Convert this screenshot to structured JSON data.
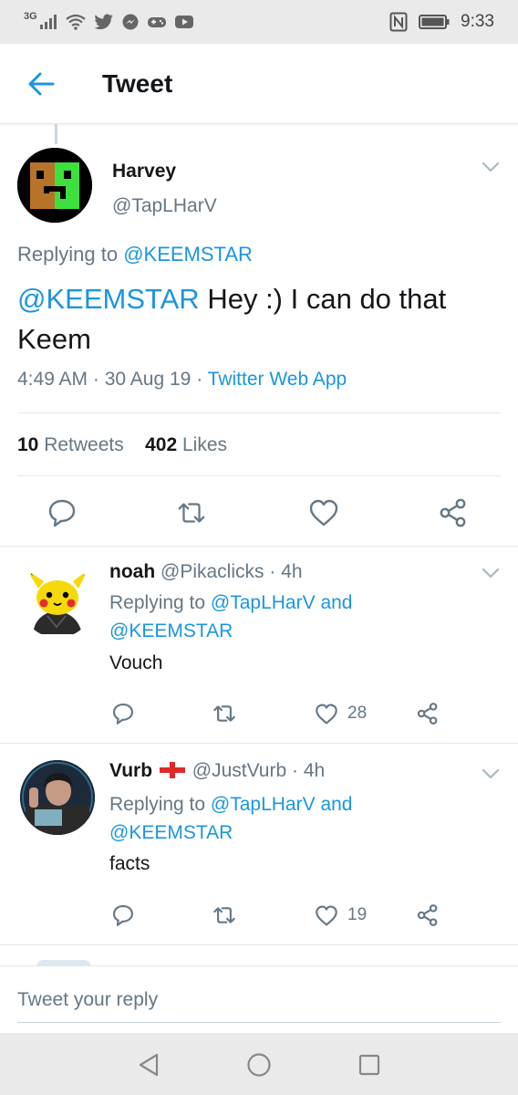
{
  "status_bar": {
    "network": "3G",
    "time": "9:33"
  },
  "header": {
    "title": "Tweet"
  },
  "main_tweet": {
    "author_name": "Harvey",
    "author_handle": "@TapLHarV",
    "replying_label": "Replying to",
    "replying_to": "@KEEMSTAR",
    "text_mention": "@KEEMSTAR",
    "text_body": "Hey :) I can do that Keem",
    "time": "4:49 AM",
    "sep": "·",
    "date": "30 Aug 19",
    "source": "Twitter Web App",
    "retweets_count": "10",
    "retweets_label": "Retweets",
    "likes_count": "402",
    "likes_label": "Likes"
  },
  "replies": [
    {
      "name": "noah",
      "flag": "",
      "handle": "@Pikaclicks",
      "sep": "·",
      "age": "4h",
      "replying_label": "Replying to",
      "reply_user1": "@TapLHarV",
      "and": "and",
      "reply_user2": "@KEEMSTAR",
      "text": "Vouch",
      "likes": "28"
    },
    {
      "name": "Vurb",
      "flag": "england-flag",
      "handle": "@JustVurb",
      "sep": "·",
      "age": "4h",
      "replying_label": "Replying to",
      "reply_user1": "@TapLHarV",
      "and": "and",
      "reply_user2": "@KEEMSTAR",
      "text": "facts",
      "likes": "19"
    }
  ],
  "compose": {
    "placeholder": "Tweet your reply"
  },
  "colors": {
    "accent": "#1b95e0",
    "secondary_text": "#657786",
    "divider": "#e1e8ed"
  }
}
